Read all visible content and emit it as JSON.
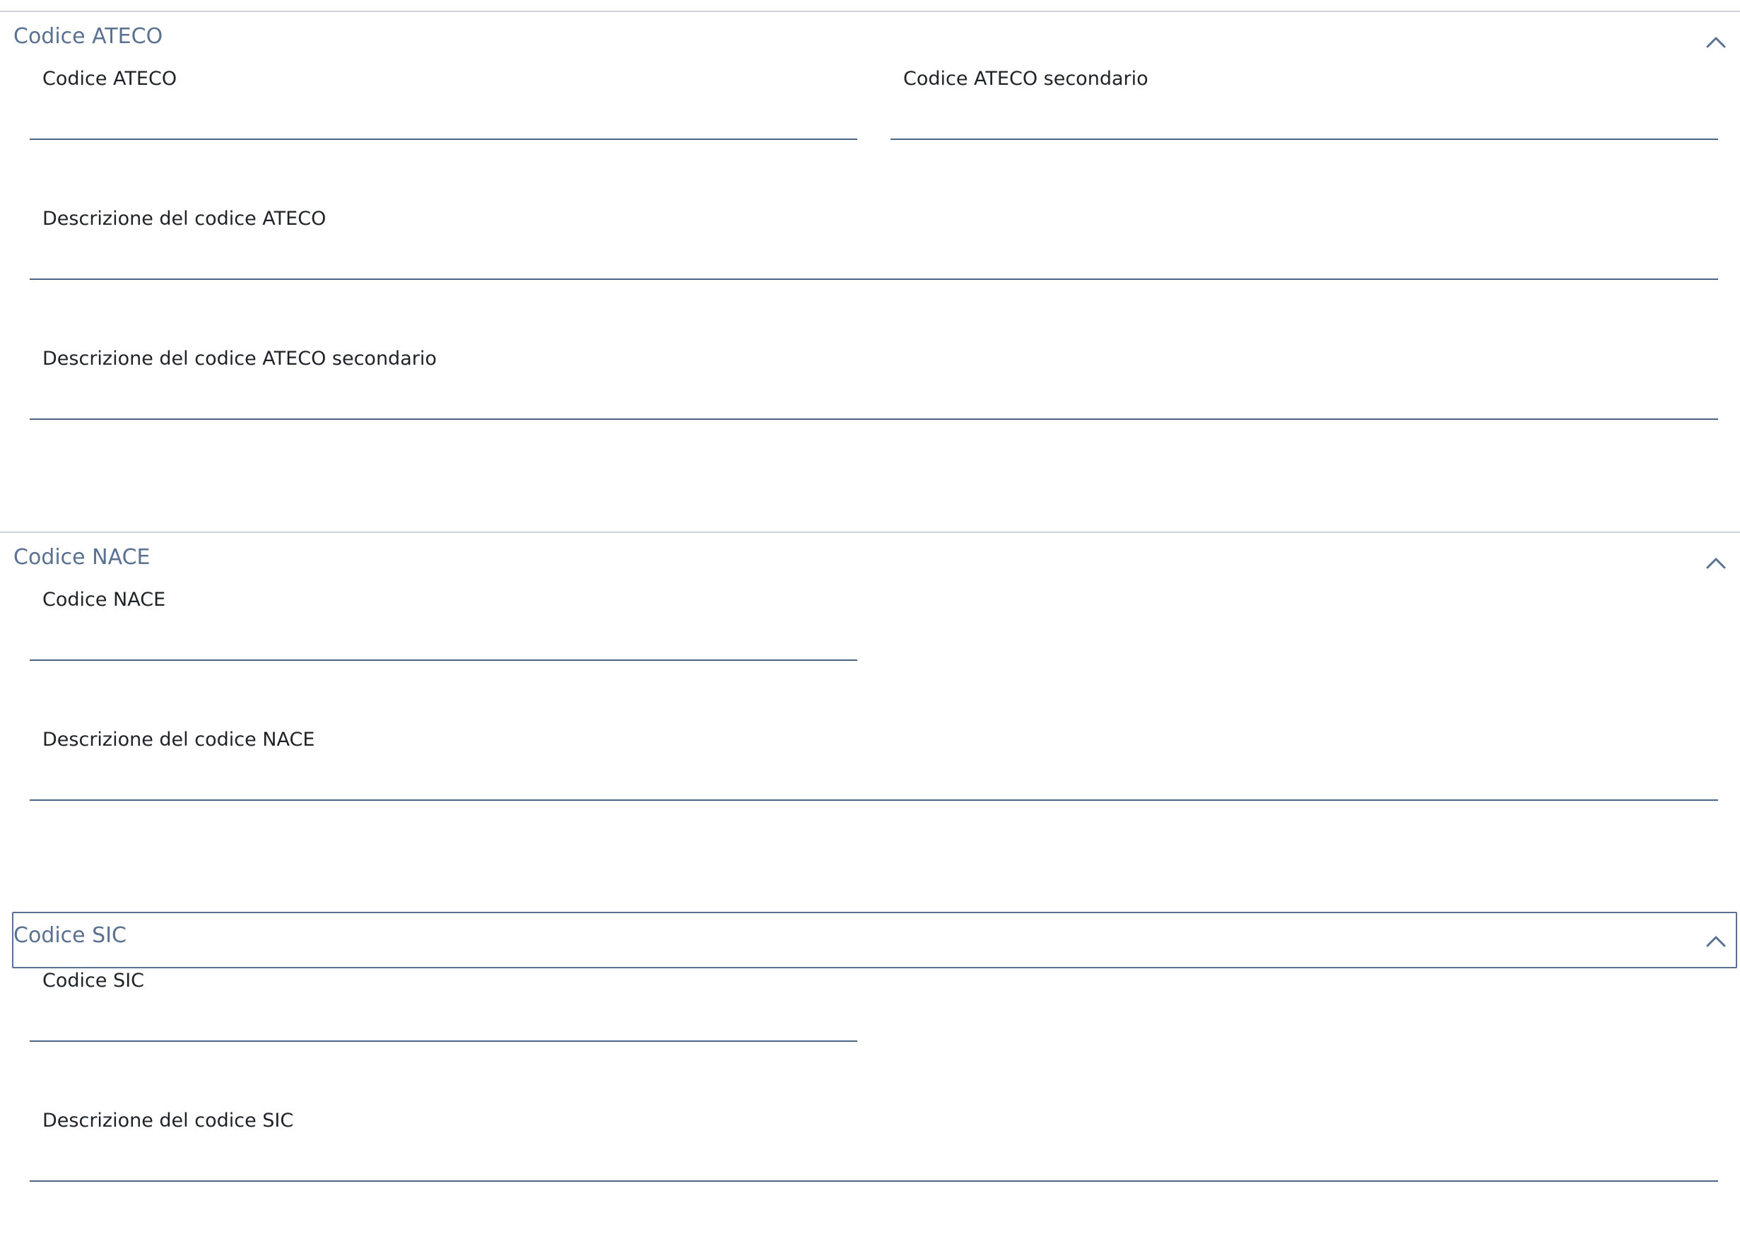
{
  "sections": {
    "ateco": {
      "title": "Codice ATECO",
      "expanded": true,
      "fields": {
        "code": {
          "label": "Codice ATECO",
          "value": ""
        },
        "secondary_code": {
          "label": "Codice ATECO secondario",
          "value": ""
        },
        "description": {
          "label": "Descrizione del codice ATECO",
          "value": ""
        },
        "secondary_description": {
          "label": "Descrizione del codice ATECO secondario",
          "value": ""
        }
      }
    },
    "nace": {
      "title": "Codice NACE",
      "expanded": true,
      "fields": {
        "code": {
          "label": "Codice NACE",
          "value": ""
        },
        "description": {
          "label": "Descrizione del codice NACE",
          "value": ""
        }
      }
    },
    "sic": {
      "title": "Codice SIC",
      "expanded": true,
      "focused": true,
      "fields": {
        "code": {
          "label": "Codice SIC",
          "value": ""
        },
        "description": {
          "label": "Descrizione del codice SIC",
          "value": ""
        }
      }
    }
  },
  "icons": {
    "collapse": "chevron-up-icon"
  },
  "colors": {
    "section_title": "#5a7191",
    "label": "#1f2226",
    "input_underline": "#4d6584",
    "divider": "#cfd3d9",
    "focus_border": "#5a7191"
  }
}
